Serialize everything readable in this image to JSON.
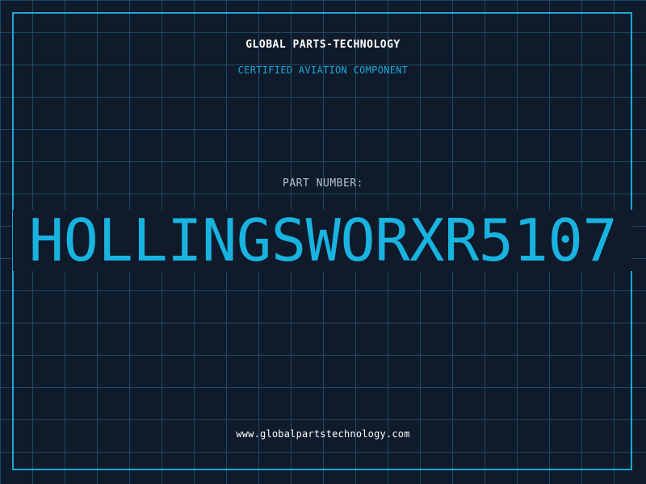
{
  "brand": "GLOBAL PARTS-TECHNOLOGY",
  "subtitle": "CERTIFIED AVIATION COMPONENT",
  "part_label": "PART NUMBER:",
  "part_number": "HOLLINGSWORXR5107",
  "website": "www.globalpartstechnology.com",
  "colors": {
    "background": "#0f1a2b",
    "grid": "#1d4a63",
    "accent": "#1ba8d6",
    "text": "#ffffff"
  }
}
